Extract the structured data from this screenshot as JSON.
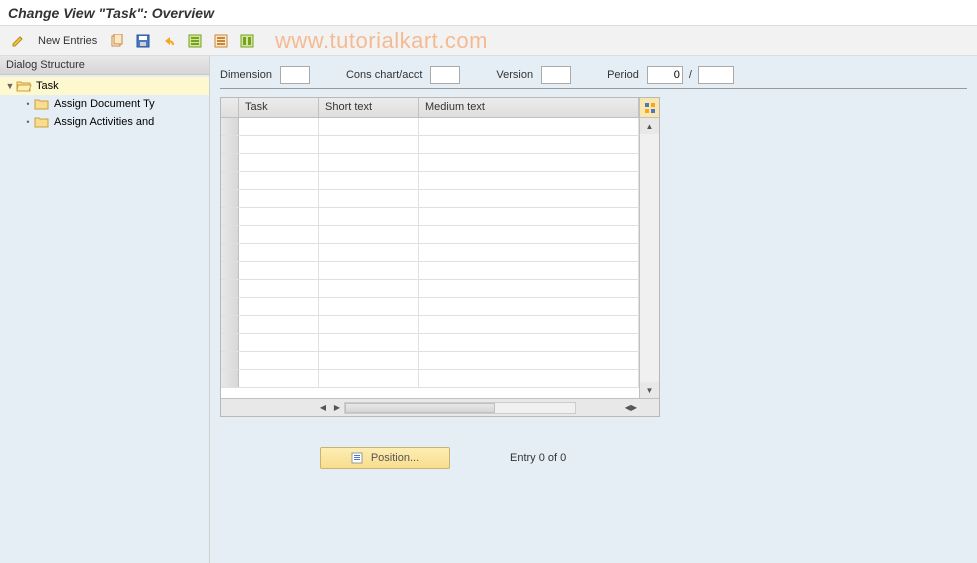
{
  "title": "Change View \"Task\": Overview",
  "toolbar": {
    "new_entries": "New Entries"
  },
  "watermark": "www.tutorialkart.com",
  "sidebar": {
    "header": "Dialog Structure",
    "items": [
      {
        "label": "Task",
        "selected": true,
        "expanded": true,
        "level": 0
      },
      {
        "label": "Assign Document Ty",
        "selected": false,
        "level": 1
      },
      {
        "label": "Assign Activities and",
        "selected": false,
        "level": 1
      }
    ]
  },
  "filters": {
    "dimension": {
      "label": "Dimension",
      "value": ""
    },
    "cons_chart": {
      "label": "Cons chart/acct",
      "value": ""
    },
    "version": {
      "label": "Version",
      "value": ""
    },
    "period": {
      "label": "Period",
      "value1": "0",
      "value2": ""
    }
  },
  "grid": {
    "columns": [
      "Task",
      "Short text",
      "Medium text"
    ],
    "rows": [],
    "row_count": 15
  },
  "footer": {
    "position_label": "Position...",
    "entry_status": "Entry 0 of 0"
  }
}
